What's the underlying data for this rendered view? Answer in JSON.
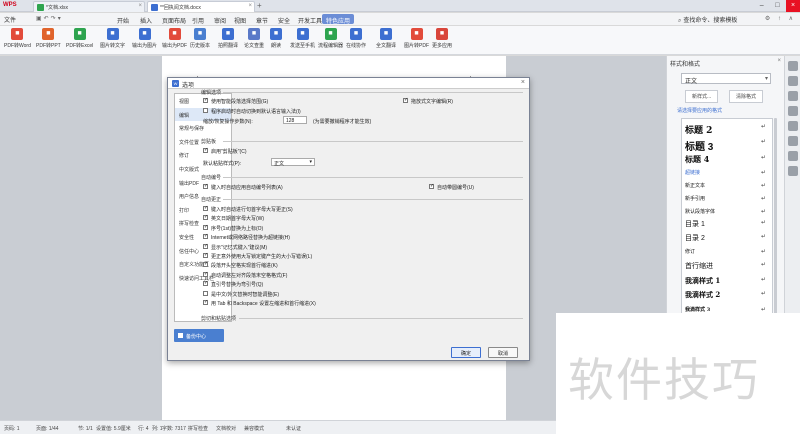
{
  "titlebar": {
    "app": "WPS",
    "tabs": [
      {
        "label": "*文档.xlsx",
        "color": "#2ea44f"
      },
      {
        "label": "**回执阅文档.docx",
        "color": "#3d6fd1"
      }
    ]
  },
  "menubar": {
    "file": "文件",
    "tabs": [
      "开始",
      "插入",
      "页面布局",
      "引用",
      "审阅",
      "视图",
      "章节",
      "安全",
      "开发工具",
      "特色应用"
    ],
    "active_tab": "特色应用",
    "search": "查找命令、搜索模板"
  },
  "toolbar": [
    {
      "label": "PDF转Word",
      "icon": "pdf-to-word-icon",
      "color": "#e24b3b"
    },
    {
      "label": "PDF转PPT",
      "icon": "pdf-to-ppt-icon",
      "color": "#e0642c"
    },
    {
      "label": "PDF转Excel",
      "icon": "pdf-to-excel-icon",
      "color": "#2ea44f"
    },
    {
      "label": "图片转文字",
      "icon": "image-to-text-icon",
      "color": "#3d6fd1"
    },
    {
      "label": "输出为图片",
      "icon": "export-image-icon",
      "color": "#3d6fd1"
    },
    {
      "label": "输出为PDF",
      "icon": "export-pdf-icon",
      "color": "#e24b3b"
    },
    {
      "label": "历史版本",
      "icon": "history-icon",
      "color": "#4a7fd0"
    },
    {
      "label": "拍照翻译",
      "icon": "photo-translate-icon",
      "color": "#3d6fd1"
    },
    {
      "label": "论文查重",
      "icon": "paper-check-icon",
      "color": "#5a79c8"
    },
    {
      "label": "朗读",
      "icon": "read-aloud-icon",
      "color": "#3d6fd1"
    },
    {
      "label": "发送至手机",
      "icon": "send-to-phone-icon",
      "color": "#3d6fd1"
    },
    {
      "label": "流程编辑器",
      "icon": "flow-editor-icon",
      "color": "#2ea44f"
    },
    {
      "label": "在线协作",
      "icon": "collaborate-icon",
      "color": "#3d6fd1"
    },
    {
      "label": "全文翻译",
      "icon": "translate-icon",
      "color": "#3d6fd1"
    },
    {
      "label": "图片转PDF",
      "icon": "image-to-pdf-icon",
      "color": "#e24b3b"
    },
    {
      "label": "更多应用",
      "icon": "more-apps-icon",
      "color": "#d9463b"
    }
  ],
  "dialog": {
    "title": "选项",
    "nav": [
      "视图",
      "编辑",
      "常规与保存",
      "文件位置",
      "修订",
      "中文版式",
      "输出PDF",
      "用户信息",
      "打印",
      "拼写检查",
      "安全性",
      "信任中心",
      "自定义功能区",
      "快速访问工具栏"
    ],
    "active_nav": "编辑",
    "backup_button": "备份中心",
    "sections": {
      "edit": "编辑选项",
      "paste": "剪贴板",
      "numbering": "自动编号",
      "autocorrect": "自动更正",
      "cutpaste": "剪切和粘贴选项"
    },
    "edit_options": [
      {
        "label": "使用智能段落选择范围(G)",
        "checked": true
      },
      {
        "label": "拖放式文字编辑(R)",
        "checked": true
      },
      {
        "label": "程序启动时自动切换到默认语言输入法(I)",
        "checked": false
      }
    ],
    "zoom_label": "缩放/恢复操作步数(N):",
    "zoom_value": "128",
    "zoom_hint": "(为需要撤销程序才能生效)",
    "paste_option": {
      "label": "启用\"剪贴板\"(C)",
      "checked": true
    },
    "paste_style_label": "默认粘贴样式(P):",
    "paste_style_value": "正文",
    "numbering_options": [
      {
        "label": "键入时自动应用自动编号列表(A)",
        "checked": true
      },
      {
        "label": "自动带圆编号(U)",
        "checked": true
      }
    ],
    "autocorrect_options": [
      {
        "label": "键入时自动进行句首字母大写更正(S)",
        "checked": true
      },
      {
        "label": "英文日期首字母大写(W)",
        "checked": true
      },
      {
        "label": "序号(1st)替换为上标(O)",
        "checked": true
      },
      {
        "label": "Internet或网络路径替换为超链接(H)",
        "checked": true
      },
      {
        "label": "显示\"记忆式键入\"建议(M)",
        "checked": true
      },
      {
        "label": "更正意外使用大写锁定键产生的大小写错误(L)",
        "checked": true
      },
      {
        "label": "段落开头空格实现首行缩进(K)",
        "checked": true
      },
      {
        "label": "自动调整左对齐段落末空格格式(F)",
        "checked": true
      },
      {
        "label": "直引号替换为弯引号(Q)",
        "checked": true
      },
      {
        "label": "是中文/外文替换时智能调整(E)",
        "checked": false
      },
      {
        "label": "用 Tab 和 Backspace 设置左缩进和首行缩进(X)",
        "checked": true
      }
    ],
    "ok": "确定",
    "cancel": "取消"
  },
  "style_panel": {
    "title": "样式和格式",
    "current": "正文",
    "new_style": "新样式...",
    "clear_format": "清除格式",
    "pick_label": "请选择要应用的格式",
    "styles": [
      {
        "label": "标题 2",
        "size": 9,
        "weight": "bold",
        "family": "serif"
      },
      {
        "label": "标题 3",
        "size": 10,
        "weight": "bold",
        "family": "sans"
      },
      {
        "label": "标题 4",
        "size": 8,
        "weight": "bold",
        "family": "serif"
      },
      {
        "label": "超链接",
        "size": 5,
        "weight": "normal",
        "family": "sans",
        "color": "#3d6fd1"
      },
      {
        "label": "新正文本",
        "size": 5,
        "weight": "normal",
        "family": "sans"
      },
      {
        "label": "新手引用",
        "size": 5,
        "weight": "normal",
        "family": "sans"
      },
      {
        "label": "默认段落字体",
        "size": 5,
        "weight": "normal",
        "family": "sans"
      },
      {
        "label": "目录 1",
        "size": 7,
        "weight": "normal",
        "family": "sans"
      },
      {
        "label": "目录 2",
        "size": 7,
        "weight": "normal",
        "family": "sans"
      },
      {
        "label": "修订",
        "size": 5,
        "weight": "normal",
        "family": "sans"
      },
      {
        "label": "首行缩进",
        "size": 7,
        "weight": "normal",
        "family": "sans"
      },
      {
        "label": "我滴样式 1",
        "size": 7,
        "weight": "bold",
        "family": "serif"
      },
      {
        "label": "我滴样式 2",
        "size": 7,
        "weight": "bold",
        "family": "serif"
      },
      {
        "label": "我滴样式 3",
        "size": 5,
        "weight": "bold",
        "family": "serif"
      }
    ]
  },
  "status": {
    "page": "页码: 1",
    "pages": "页面: 1/44",
    "section": "节: 1/1",
    "setting": "设置值: 5.9厘米",
    "row": "行: 4",
    "col": "列: 1",
    "words": "字数: 7317",
    "spell": "拼写检查",
    "doc_check": "文档校对",
    "compat": "兼容模式",
    "save": "未认证"
  },
  "watermark": "软件技巧"
}
